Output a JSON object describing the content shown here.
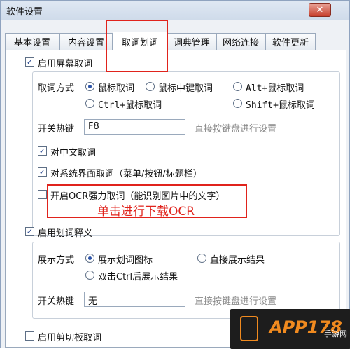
{
  "window": {
    "title": "软件设置",
    "close_glyph": "✕"
  },
  "tabs": [
    {
      "label": "基本设置"
    },
    {
      "label": "内容设置"
    },
    {
      "label": "取词划词"
    },
    {
      "label": "词典管理"
    },
    {
      "label": "网络连接"
    },
    {
      "label": "软件更新"
    }
  ],
  "capture": {
    "enable_label": "启用屏幕取词",
    "enable_checked": true,
    "method_label": "取词方式",
    "methods": [
      {
        "label": "鼠标取词",
        "selected": true
      },
      {
        "label": "鼠标中键取词",
        "selected": false
      },
      {
        "label": "Alt+鼠标取词",
        "selected": false
      },
      {
        "label": "Ctrl+鼠标取词",
        "selected": false
      },
      {
        "label": "Shift+鼠标取词",
        "selected": false
      }
    ],
    "hotkey_label": "开关热键",
    "hotkey_value": "F8",
    "hotkey_hint": "直接按键盘进行设置",
    "chinese_label": "对中文取词",
    "chinese_checked": true,
    "ui_label": "对系统界面取词（菜单/按钮/标题栏）",
    "ui_checked": true,
    "ocr_label": "开启OCR强力取词（能识别图片中的文字）",
    "ocr_checked": false
  },
  "annotation": {
    "text": "单击进行下载OCR",
    "color": "#e0231c"
  },
  "translate": {
    "enable_label": "启用划词释义",
    "enable_checked": true,
    "display_label": "展示方式",
    "modes": [
      {
        "label": "展示划词图标",
        "selected": true
      },
      {
        "label": "直接展示结果",
        "selected": false
      },
      {
        "label": "双击Ctrl后展示结果",
        "selected": false
      }
    ],
    "hotkey_label": "开关热键",
    "hotkey_value": "无",
    "hotkey_hint": "直接按键盘进行设置"
  },
  "clipboard": {
    "enable_label": "启用剪切板取词",
    "enable_checked": false
  },
  "watermark": {
    "brand": "APP178",
    "sub": "手游网"
  }
}
